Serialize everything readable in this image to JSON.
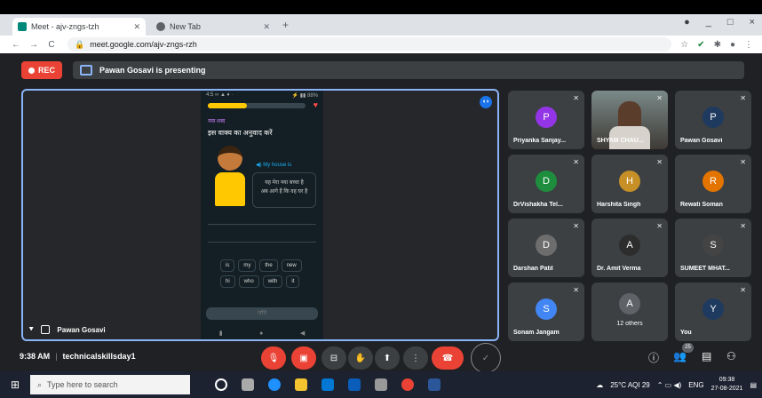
{
  "browser": {
    "tabs": [
      {
        "title": "Meet - ajv-zngs-tzh",
        "active": true
      },
      {
        "title": "New Tab",
        "active": false
      }
    ],
    "url": "meet.google.com/ajv-zngs-rzh",
    "window_controls": [
      "_",
      "□",
      "×"
    ]
  },
  "meet": {
    "rec_label": "REC",
    "presenting_text": "Pawan Gosavi is presenting",
    "stage_name": "Pawan Gosavi",
    "phone": {
      "status_left": "4:5 ∞ ▲ ♦ ·",
      "status_right": "⚡ ▮▮ 88%",
      "new_word": "नया शब्द",
      "question": "इस वाक्य का अनुवाद करें",
      "speaker_label": "◀) My house is",
      "bubble_line1": "यह मेरा नया बच्चा है",
      "bubble_line2": "अब आगे हैं कि वह घर है",
      "word_row1": [
        "is",
        "my",
        "the",
        "new"
      ],
      "word_row2": [
        "hi",
        "who",
        "with",
        "it"
      ],
      "check_label": "जाँचें",
      "nav": [
        "▮",
        "●",
        "◀"
      ]
    },
    "participants": [
      {
        "name": "Priyanka Sanjay...",
        "initial": "P",
        "color": "#9334e6"
      },
      {
        "name": "SHYAM CHAU...",
        "initial": "",
        "color": "",
        "camera": true
      },
      {
        "name": "Pawan Gosavi",
        "initial": "P",
        "color": "#1e3a5f"
      },
      {
        "name": "DrVishakha Tel...",
        "initial": "D",
        "color": "#1e8e3e"
      },
      {
        "name": "Harshita Singh",
        "initial": "H",
        "color": "#c69026"
      },
      {
        "name": "Rewati Soman",
        "initial": "R",
        "color": "#e37400"
      },
      {
        "name": "Darshan Patil",
        "initial": "D",
        "color": "#6d6d6d"
      },
      {
        "name": "Dr. Amit Verma",
        "initial": "A",
        "color": "#2d2d2d"
      },
      {
        "name": "SUMEET MHAT...",
        "initial": "S",
        "color": "#444444"
      },
      {
        "name": "Sonam Jangam",
        "initial": "S",
        "color": "#4285f4"
      },
      {
        "name": "12 others",
        "initial": "A",
        "color": "#5f6368"
      },
      {
        "name": "You",
        "initial": "Y",
        "color": "#1e3a5f"
      }
    ],
    "time": "9:38 AM",
    "meeting_code": "technicalskillsday1",
    "people_count": "25"
  },
  "taskbar": {
    "search_placeholder": "Type here to search",
    "weather": "25°C AQI 29",
    "lang": "ENG",
    "clock_time": "09:38",
    "clock_date": "27-08-2021"
  }
}
